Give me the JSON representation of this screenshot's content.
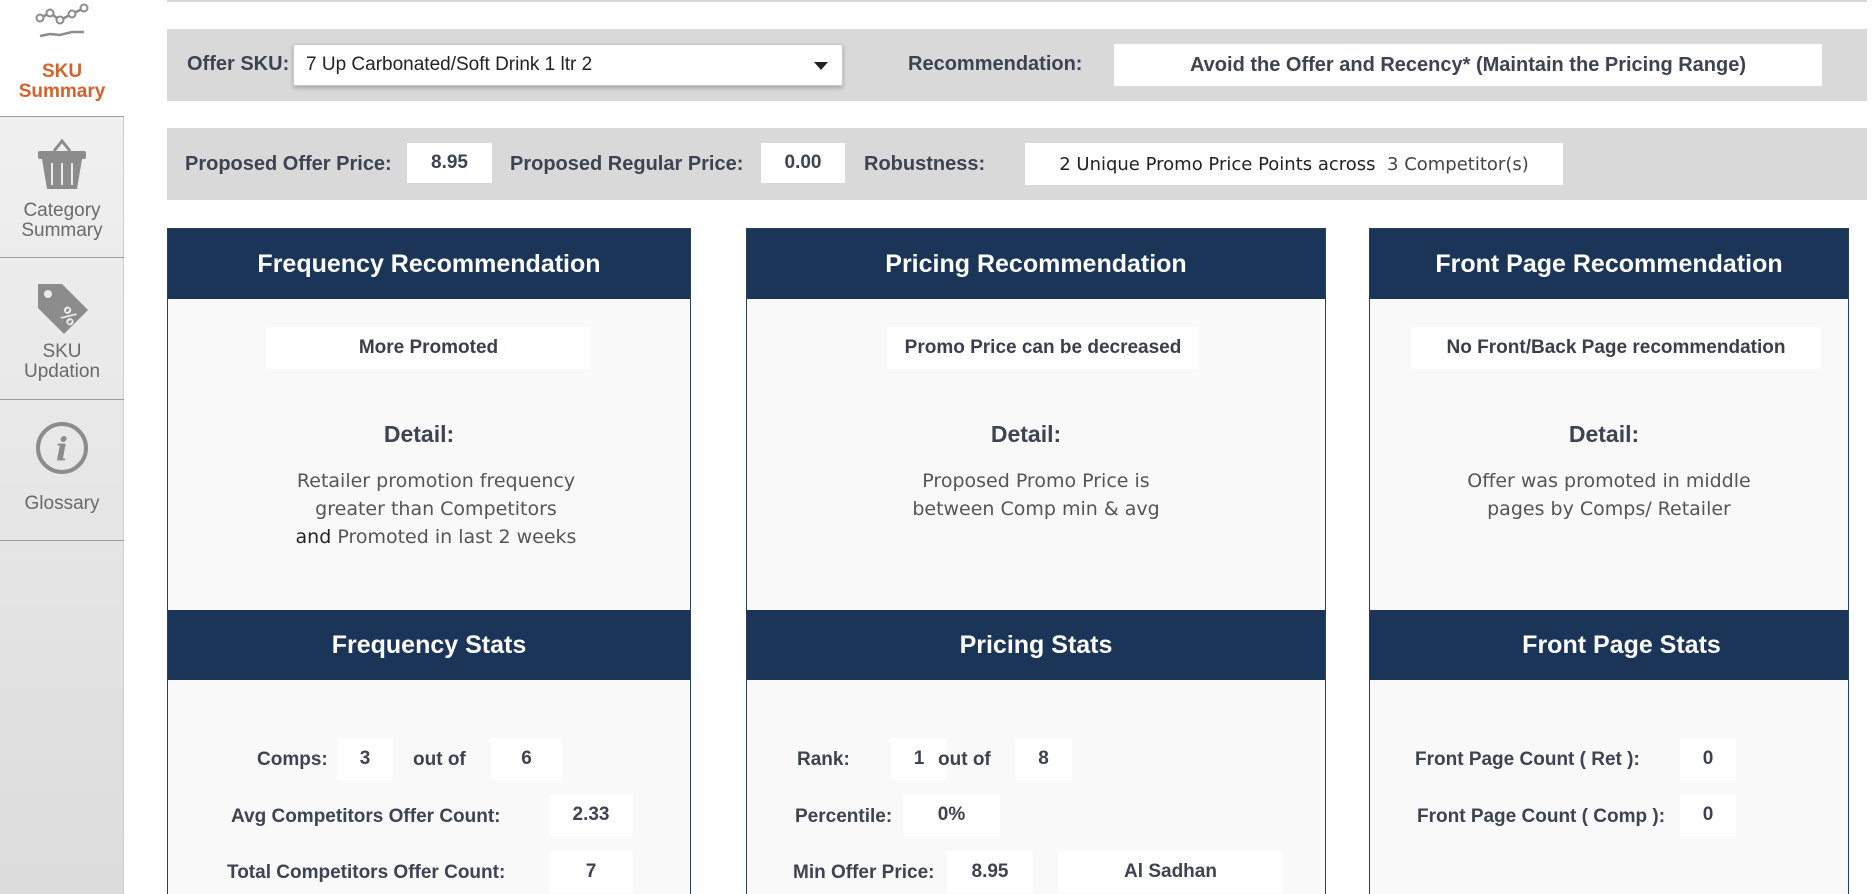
{
  "sidebar": {
    "items": [
      {
        "label": "SKU Summary",
        "icon": "line-chart-icon",
        "active": true
      },
      {
        "label": "Category Summary",
        "icon": "basket-icon",
        "active": false
      },
      {
        "label": "SKU Updation",
        "icon": "price-tag-icon",
        "active": false
      },
      {
        "label": "Glossary",
        "icon": "info-icon",
        "active": false
      }
    ]
  },
  "filters": {
    "offer_sku_label": "Offer SKU:",
    "offer_sku_value": "7 Up Carbonated/Soft Drink 1 ltr 2",
    "recommendation_label": "Recommendation:",
    "recommendation_value": "Avoid the Offer and Recency* (Maintain the Pricing Range)",
    "proposed_offer_price_label": "Proposed Offer Price:",
    "proposed_offer_price_value": "8.95",
    "proposed_regular_price_label": "Proposed Regular Price:",
    "proposed_regular_price_value": "0.00",
    "robustness_label": "Robustness:",
    "robustness_value": "2 Unique Promo Price Points across",
    "robustness_competitors": "3 Competitor(s)"
  },
  "frequency": {
    "title": "Frequency Recommendation",
    "recommendation": "More Promoted",
    "detail_title": "Detail:",
    "detail_line1": "Retailer promotion frequency",
    "detail_line2": "greater than Competitors",
    "detail_and": "and",
    "detail_line3": "Promoted in last 2 weeks",
    "stats_title": "Frequency Stats",
    "comps_label": "Comps:",
    "comps_value": "3",
    "out_of_label": "out of",
    "out_of_value": "6",
    "avg_label": "Avg Competitors Offer Count:",
    "avg_value": "2.33",
    "total_label": "Total Competitors Offer Count:",
    "total_value": "7"
  },
  "pricing": {
    "title": "Pricing Recommendation",
    "recommendation": "Promo Price can be decreased",
    "detail_title": "Detail:",
    "detail_line1": "Proposed Promo Price is",
    "detail_line2": "between Comp min & avg",
    "stats_title": "Pricing Stats",
    "rank_label": "Rank:",
    "rank_value": "1",
    "out_of_label": "out of",
    "out_of_value": "8",
    "percentile_label": "Percentile:",
    "percentile_value": "0%",
    "min_offer_label": "Min Offer Price:",
    "min_offer_value": "8.95",
    "min_offer_retailer": "Al Sadhan"
  },
  "front_page": {
    "title": "Front Page Recommendation",
    "recommendation": "No Front/Back Page recommendation",
    "detail_title": "Detail:",
    "detail_line1": "Offer was promoted in middle",
    "detail_line2": "pages by Comps/ Retailer",
    "stats_title": "Front Page Stats",
    "ret_label": "Front Page Count ( Ret ):",
    "ret_value": "0",
    "comp_label": "Front Page Count ( Comp ):",
    "comp_value": "0"
  },
  "colors": {
    "header_navy": "#1a3557",
    "active_nav": "#d4622c",
    "bar_gray": "#d9d9d9"
  }
}
